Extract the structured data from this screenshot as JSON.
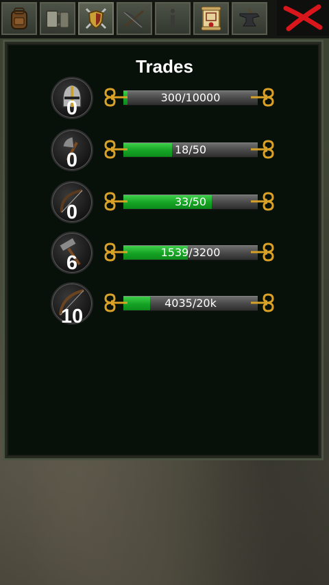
{
  "tabs": [
    {
      "name": "backpack-icon"
    },
    {
      "name": "tankard-icon"
    },
    {
      "name": "shield-swords-icon"
    },
    {
      "name": "crossbow-icon"
    },
    {
      "name": "info-icon"
    },
    {
      "name": "scroll-icon"
    },
    {
      "name": "anvil-icon"
    }
  ],
  "close": {
    "icon": "close-x-icon",
    "color": "#d8161b"
  },
  "panel": {
    "title": "Trades"
  },
  "trades": [
    {
      "icon": "helmet-icon",
      "count": "0",
      "progress_text": "300/10000",
      "progress": 0.03
    },
    {
      "icon": "axe-icon",
      "count": "0",
      "progress_text": "18/50",
      "progress": 0.36
    },
    {
      "icon": "bow-icon",
      "count": "0",
      "progress_text": "33/50",
      "progress": 0.66
    },
    {
      "icon": "hammer-icon",
      "count": "6",
      "progress_text": "1539/3200",
      "progress": 0.48
    },
    {
      "icon": "longbow-icon",
      "count": "10",
      "progress_text": "4035/20k",
      "progress": 0.2
    }
  ],
  "colors": {
    "progress_fill": "#17a626",
    "ornament_gold": "#d9a227",
    "panel_bg": "#08100a"
  }
}
